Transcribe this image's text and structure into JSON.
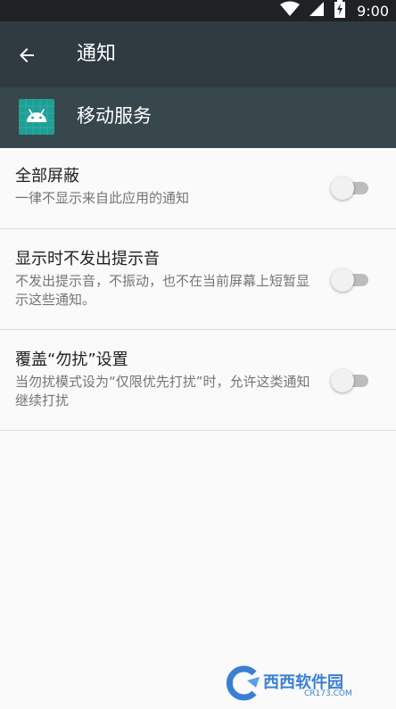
{
  "status_bar": {
    "time": "9:00"
  },
  "app_bar": {
    "title": "通知"
  },
  "app_header": {
    "app_name": "移动服务",
    "icon_color": "#1f9e96"
  },
  "settings": [
    {
      "title": "全部屏蔽",
      "summary": "一律不显示来自此应用的通知",
      "enabled": false
    },
    {
      "title": "显示时不发出提示音",
      "summary": "不发出提示音，不振动，也不在当前屏幕上短暂显示这些通知。",
      "enabled": false
    },
    {
      "title": "覆盖“勿扰”设置",
      "summary": "当勿扰模式设为“仅限优先打扰”时，允许这类通知继续打扰",
      "enabled": false
    }
  ],
  "watermark": {
    "text": "西西软件园",
    "sub": "CR173.COM"
  }
}
